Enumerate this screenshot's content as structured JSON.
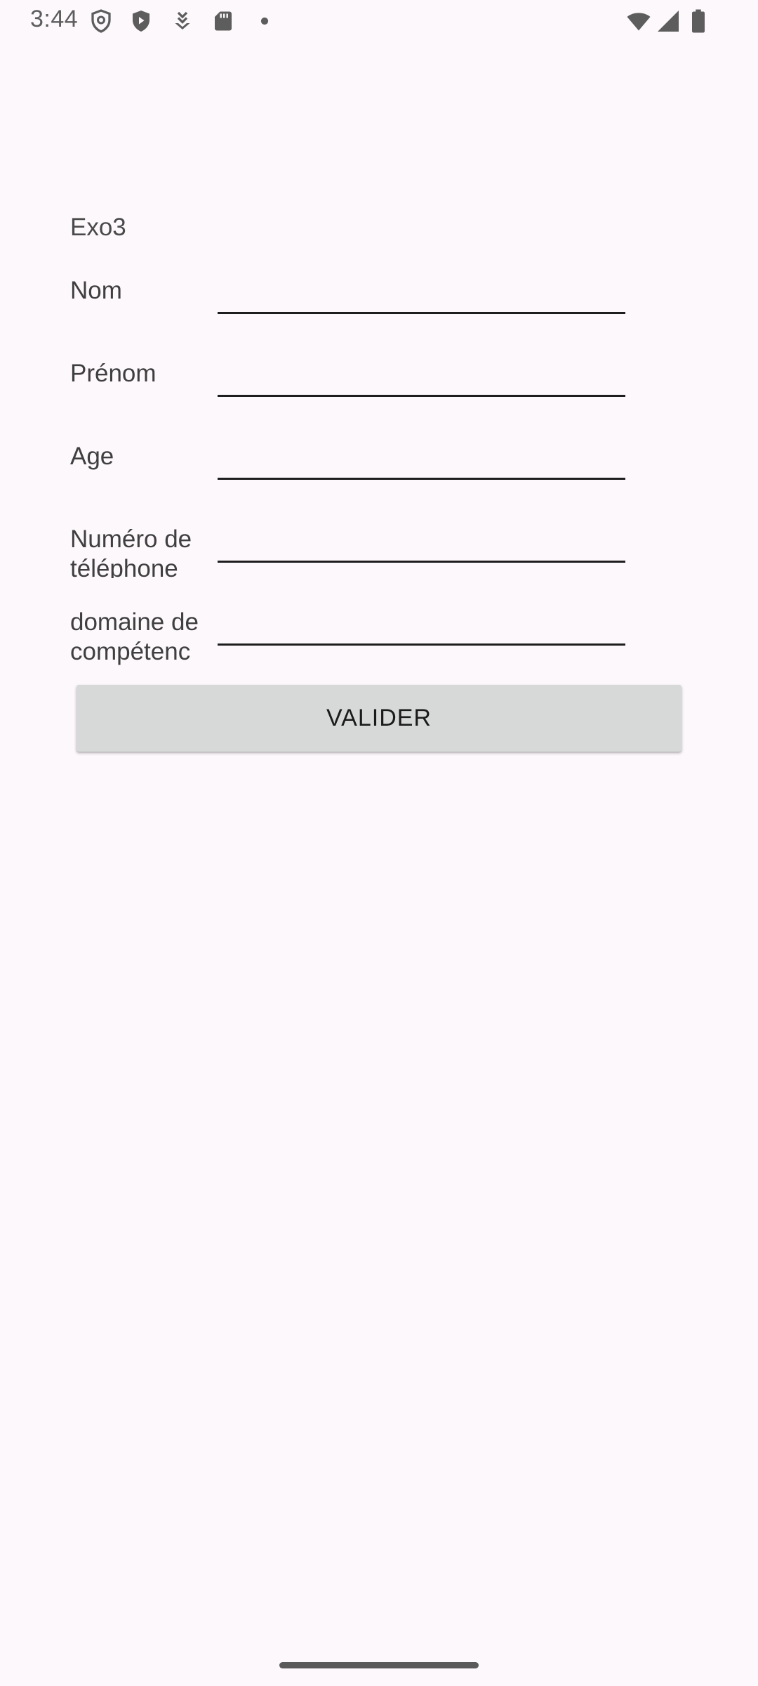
{
  "status_bar": {
    "time": "3:44",
    "left_icons": [
      "vpn-shield-icon",
      "play-protect-icon",
      "download-icon",
      "sd-card-icon",
      "notification-dot-icon"
    ],
    "right_icons": [
      "wifi-icon",
      "cell-signal-icon",
      "battery-icon"
    ]
  },
  "form": {
    "title": "Exo3",
    "fields": [
      {
        "label": "Nom",
        "value": ""
      },
      {
        "label": "Prénom",
        "value": ""
      },
      {
        "label": "Age",
        "value": ""
      },
      {
        "label": "Numéro de téléphone",
        "value": ""
      },
      {
        "label": "domaine de compétenc",
        "value": ""
      }
    ],
    "submit_label": "VALIDER"
  },
  "colors": {
    "background": "#fdf8fc",
    "button": "#d7d8d8",
    "input_underline": "#1e1e1e"
  }
}
